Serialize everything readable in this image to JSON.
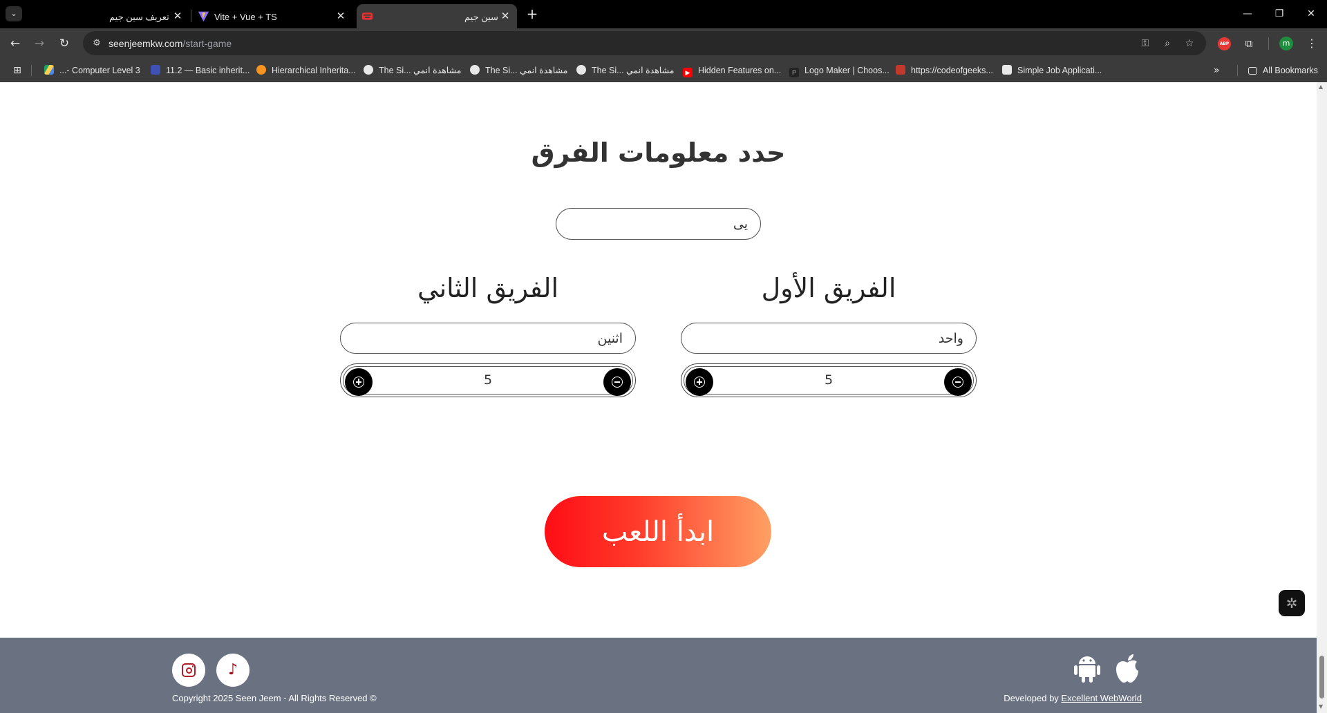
{
  "browser": {
    "tabs": [
      {
        "title": "تعريف سين جيم",
        "active": false
      },
      {
        "title": "Vite + Vue + TS",
        "active": false
      },
      {
        "title": "سين جيم",
        "active": true
      }
    ],
    "url_domain": "seenjeemkw.com",
    "url_path": "/start-game",
    "bookmarks": [
      "...- Computer Level 3",
      "11.2 — Basic inherit...",
      "Hierarchical Inherita...",
      "The Si... مشاهدة انمي",
      "The Si... مشاهدة انمي",
      "The Si... مشاهدة انمي",
      "Hidden Features on...",
      "Logo Maker | Choos...",
      "https://codeofgeeks...",
      "Simple Job Applicati..."
    ],
    "all_bookmarks": "All Bookmarks",
    "profile_initial": "m",
    "abp_label": "ABP"
  },
  "page": {
    "heading": "حدد معلومات الفرق",
    "game_name_value": "يى",
    "team1": {
      "title": "الفريق الأول",
      "name_value": "واحد",
      "count": "5"
    },
    "team2": {
      "title": "الفريق الثاني",
      "name_value": "اثنين",
      "count": "5"
    },
    "start_button": "ابدأ اللعب"
  },
  "footer": {
    "copyright": "Copyright 2025 Seen Jeem - All Rights Reserved ©",
    "developed_by": "Developed by",
    "developer_link": "Excellent WebWorld"
  },
  "colors": {
    "start_gradient_left": "#ff0d15",
    "start_gradient_right": "#ffa064",
    "footer_bg": "#6a7281",
    "social_accent": "#b01e2a"
  }
}
